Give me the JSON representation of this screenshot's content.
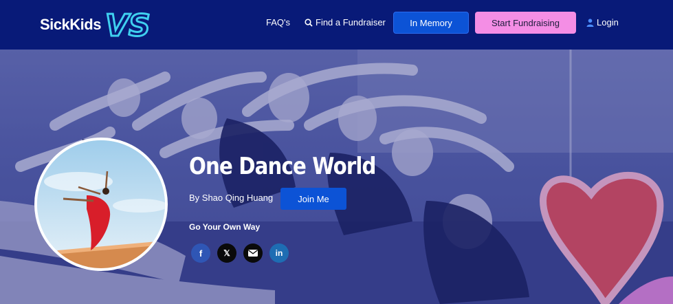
{
  "brand": {
    "name": "SickKids",
    "vs": "VS"
  },
  "nav": {
    "faq": "FAQ's",
    "find": "Find a Fundraiser",
    "memory": "In Memory",
    "start": "Start Fundraising",
    "login": "Login"
  },
  "hero": {
    "title": "One Dance World",
    "byline": "By Shao Qing Huang",
    "join": "Join Me",
    "tagline": "Go Your Own Way"
  },
  "social": {
    "facebook": "f",
    "x": "𝕏",
    "email": "email-icon",
    "linkedin": "in"
  },
  "colors": {
    "header_bg": "#081a78",
    "primary_button": "#0c53d6",
    "fundraise_button": "#f48ee5",
    "heart": "#e0505f",
    "logo_glow": "#3fd0f0"
  }
}
